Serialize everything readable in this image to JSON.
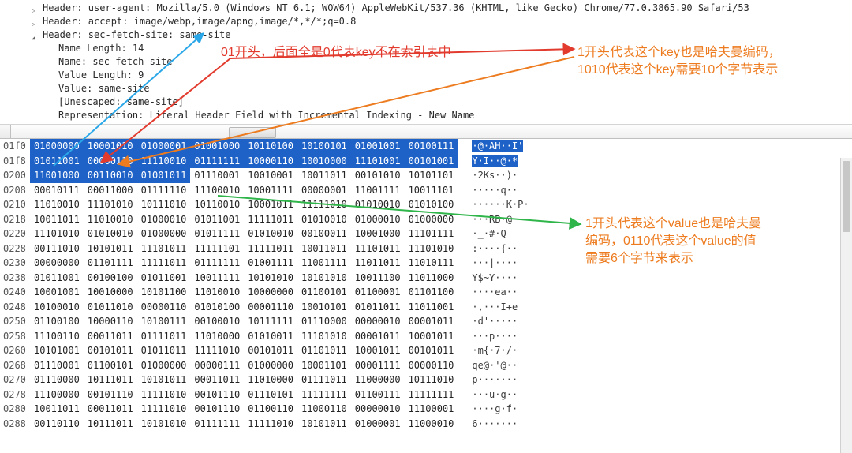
{
  "tree": {
    "row0": "Header: user-agent: Mozilla/5.0 (Windows NT 6.1; WOW64) AppleWebKit/537.36 (KHTML, like Gecko) Chrome/77.0.3865.90 Safari/53",
    "row1": "Header: accept: image/webp,image/apng,image/*,*/*;q=0.8",
    "row2": "Header: sec-fetch-site: same-site",
    "row2a": "Name Length: 14",
    "row2b": "Name: sec-fetch-site",
    "row2c": "Value Length: 9",
    "row2d": "Value: same-site",
    "row2e": "[Unescaped: same-site]",
    "row2f": "Representation: Literal Header Field with Incremental Indexing - New Name"
  },
  "hex": {
    "rows": [
      {
        "off": "01f0",
        "b": [
          "01000000",
          "10001010",
          "01000001",
          "01001000",
          "10110100",
          "10100101",
          "01001001",
          "00100111"
        ],
        "a": "·@·AH··I'",
        "sel": [
          0,
          1,
          2,
          3,
          4,
          5,
          6,
          7
        ],
        "asel": true
      },
      {
        "off": "01f8",
        "b": [
          "01011001",
          "00000110",
          "11110010",
          "01111111",
          "10000110",
          "10010000",
          "11101001",
          "00101001"
        ],
        "a": "Y·I··@·*",
        "sel": [
          0,
          1,
          2,
          3,
          4,
          5,
          6,
          7
        ],
        "asel": true
      },
      {
        "off": "0200",
        "b": [
          "11001000",
          "00110010",
          "01001011",
          "01110001",
          "10010001",
          "10011011",
          "00101010",
          "10101101"
        ],
        "a": "·2Ks··)·",
        "sel": [
          0,
          1,
          2
        ],
        "asel": false
      },
      {
        "off": "0208",
        "b": [
          "00010111",
          "00011000",
          "01111110",
          "11100010",
          "10001111",
          "00000001",
          "11001111",
          "10011101"
        ],
        "a": "·····q··",
        "sel": [],
        "asel": false
      },
      {
        "off": "0210",
        "b": [
          "11010010",
          "11101010",
          "10111010",
          "10110010",
          "10001011",
          "11111010",
          "01010010",
          "01010100"
        ],
        "a": "······K·P·",
        "sel": [],
        "asel": false
      },
      {
        "off": "0218",
        "b": [
          "10011011",
          "11010010",
          "01000010",
          "01011001",
          "11111011",
          "01010010",
          "01000010",
          "01000000"
        ],
        "a": "···RB·@",
        "sel": [],
        "asel": false
      },
      {
        "off": "0220",
        "b": [
          "11101010",
          "01010010",
          "01000000",
          "01011111",
          "01010010",
          "00100011",
          "10001000",
          "11101111"
        ],
        "a": "·_·#·Q",
        "sel": [],
        "asel": false
      },
      {
        "off": "0228",
        "b": [
          "00111010",
          "10101011",
          "11101011",
          "11111101",
          "11111011",
          "10011011",
          "11101011",
          "11101010"
        ],
        "a": ":····{··",
        "sel": [],
        "asel": false
      },
      {
        "off": "0230",
        "b": [
          "00000000",
          "01101111",
          "11111011",
          "01111111",
          "01001111",
          "11001111",
          "11011011",
          "11010111"
        ],
        "a": "···|····",
        "sel": [],
        "asel": false
      },
      {
        "off": "0238",
        "b": [
          "01011001",
          "00100100",
          "01011001",
          "10011111",
          "10101010",
          "10101010",
          "10011100",
          "11011000"
        ],
        "a": "Y$~Y····",
        "sel": [],
        "asel": false
      },
      {
        "off": "0240",
        "b": [
          "10001001",
          "10010000",
          "10101100",
          "11010010",
          "10000000",
          "01100101",
          "01100001",
          "01101100"
        ],
        "a": "····ea··",
        "sel": [],
        "asel": false
      },
      {
        "off": "0248",
        "b": [
          "10100010",
          "01011010",
          "00000110",
          "01010100",
          "00001110",
          "10010101",
          "01011011",
          "11011001"
        ],
        "a": "·,···I+e",
        "sel": [],
        "asel": false
      },
      {
        "off": "0250",
        "b": [
          "01100100",
          "10000110",
          "10100111",
          "00100010",
          "10111111",
          "01110000",
          "00000010",
          "00001011"
        ],
        "a": "·d'·····",
        "sel": [],
        "asel": false
      },
      {
        "off": "0258",
        "b": [
          "11100110",
          "00011011",
          "01111011",
          "11010000",
          "01010011",
          "11101010",
          "00001011",
          "10001011"
        ],
        "a": "···p····",
        "sel": [],
        "asel": false
      },
      {
        "off": "0260",
        "b": [
          "10101001",
          "00101011",
          "01011011",
          "11111010",
          "00101011",
          "01101011",
          "10001011",
          "00101011"
        ],
        "a": "·m{·7·/·",
        "sel": [],
        "asel": false
      },
      {
        "off": "0268",
        "b": [
          "01110001",
          "01100101",
          "01000000",
          "00000111",
          "01000000",
          "10001101",
          "00001111",
          "00000110"
        ],
        "a": "qe@·'@··",
        "sel": [],
        "asel": false
      },
      {
        "off": "0270",
        "b": [
          "01110000",
          "10111011",
          "10101011",
          "00011011",
          "11010000",
          "01111011",
          "11000000",
          "10111010"
        ],
        "a": "p·······",
        "sel": [],
        "asel": false
      },
      {
        "off": "0278",
        "b": [
          "11100000",
          "00101110",
          "11111010",
          "00101110",
          "01110101",
          "11111111",
          "01100111",
          "11111111"
        ],
        "a": "···u·g··",
        "sel": [],
        "asel": false
      },
      {
        "off": "0280",
        "b": [
          "10011011",
          "00011011",
          "11111010",
          "00101110",
          "01100110",
          "11000110",
          "00000010",
          "11100001"
        ],
        "a": "····g·f·",
        "sel": [],
        "asel": false
      },
      {
        "off": "0288",
        "b": [
          "00110110",
          "10111011",
          "10101010",
          "01111111",
          "11111010",
          "10101011",
          "01000001",
          "11000010"
        ],
        "a": "6·······",
        "sel": [],
        "asel": false
      }
    ]
  },
  "annot": {
    "red": "01开头，后面全是0代表key不在索引表中",
    "orange1a": "1开头代表这个key也是哈夫曼编码，",
    "orange1b": "1010代表这个key需要10个字节表示",
    "orange2a": "1开头代表这个value也是哈夫曼",
    "orange2b": "编码，0110代表这个value的值",
    "orange2c": "需要6个字节来表示"
  }
}
